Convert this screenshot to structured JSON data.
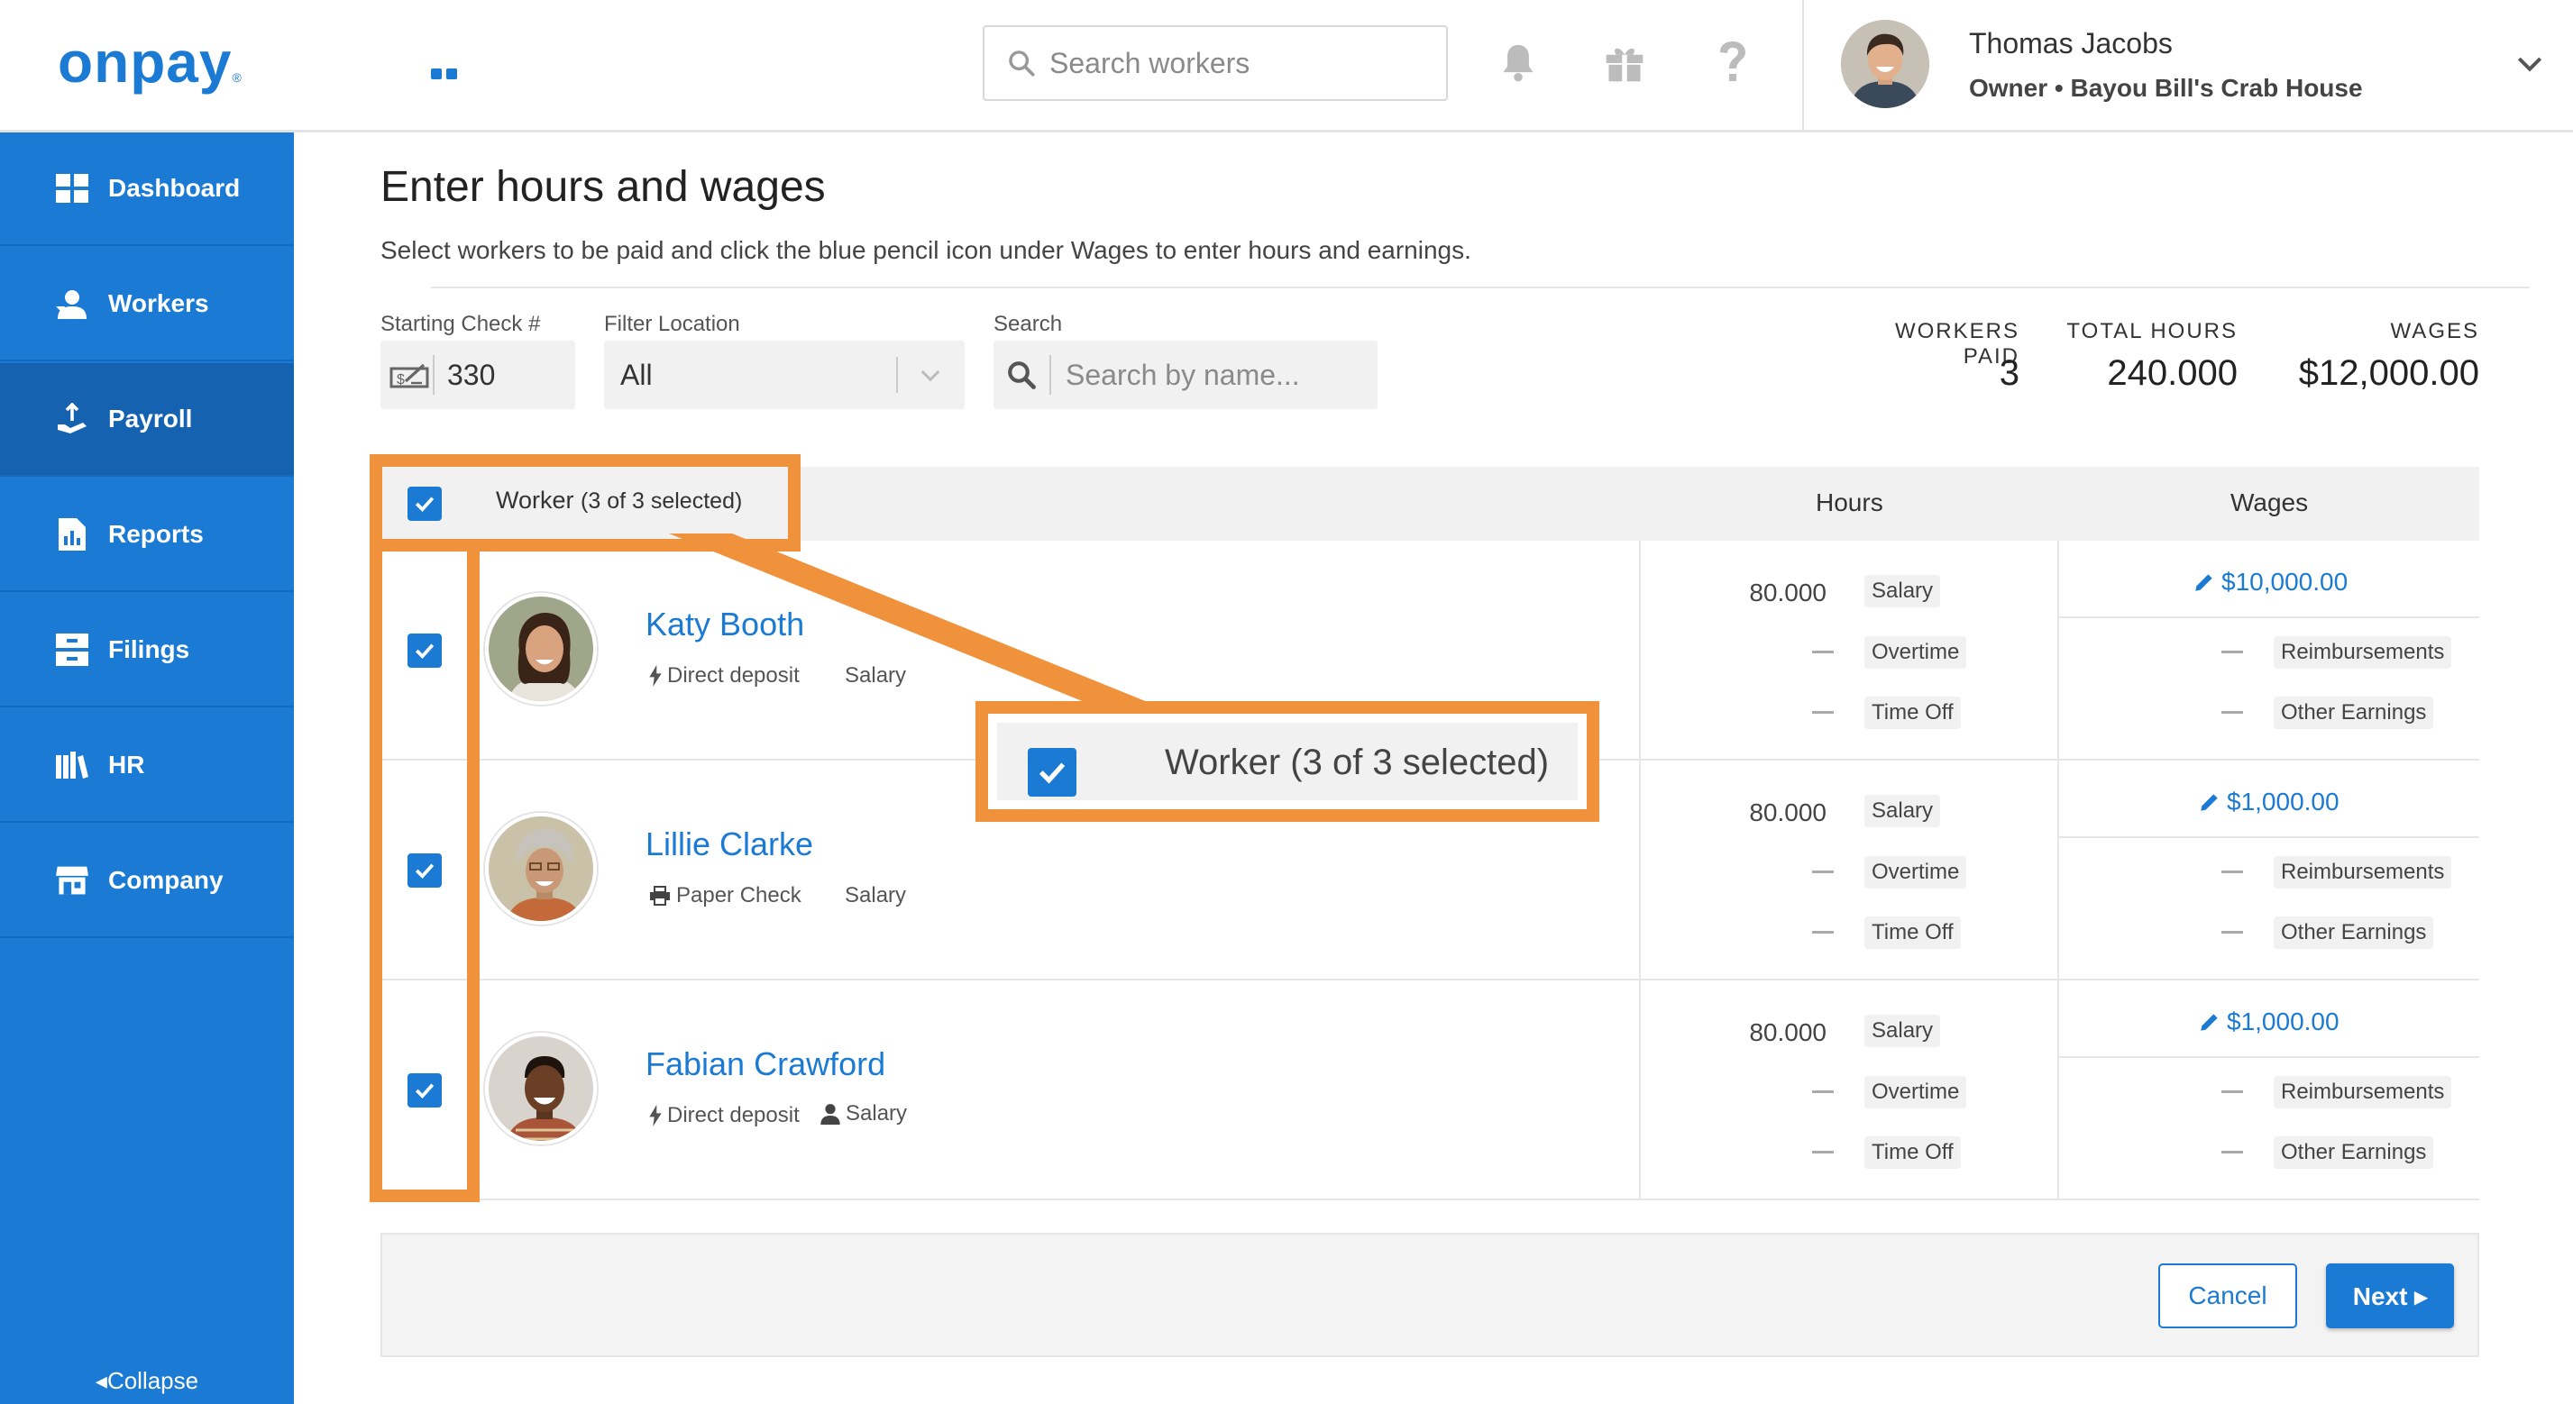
{
  "brand": {
    "name": "onpay",
    "reg_mark": "®",
    "accent": "#1a7ad4",
    "annotation": "#f0913b"
  },
  "topbar": {
    "search_placeholder": "Search workers",
    "icons": [
      "bell-icon",
      "gift-icon",
      "help-icon"
    ],
    "user": {
      "name": "Thomas Jacobs",
      "role": "Owner • Bayou Bill's Crab House"
    }
  },
  "sidebar": {
    "items": [
      {
        "label": "Dashboard",
        "icon": "dashboard-icon"
      },
      {
        "label": "Workers",
        "icon": "workers-icon"
      },
      {
        "label": "Payroll",
        "icon": "payroll-icon",
        "active": true
      },
      {
        "label": "Reports",
        "icon": "reports-icon"
      },
      {
        "label": "Filings",
        "icon": "filings-icon"
      },
      {
        "label": "HR",
        "icon": "hr-icon"
      },
      {
        "label": "Company",
        "icon": "company-icon"
      }
    ],
    "collapse_label": "Collapse"
  },
  "page": {
    "title": "Enter hours and wages",
    "subtitle": "Select workers to be paid and click the blue pencil icon under Wages to enter hours and earnings."
  },
  "filters": {
    "check_label": "Starting Check #",
    "check_value": "330",
    "location_label": "Filter Location",
    "location_value": "All",
    "search_label": "Search",
    "search_placeholder": "Search by name..."
  },
  "stats": {
    "workers_paid_label": "WORKERS PAID",
    "workers_paid": "3",
    "total_hours_label": "TOTAL HOURS",
    "total_hours": "240.000",
    "wages_label": "WAGES",
    "wages": "$12,000.00"
  },
  "table": {
    "header_worker": "Worker",
    "header_worker_count": "(3 of 3 selected)",
    "header_hours": "Hours",
    "header_wages": "Wages",
    "hour_tags": [
      "Salary",
      "Overtime",
      "Time Off"
    ],
    "wage_tags": [
      "Reimbursements",
      "Other Earnings"
    ],
    "rows": [
      {
        "name": "Katy Booth",
        "payment": "Direct deposit",
        "type": "Salary",
        "hours": "80.000",
        "wage": "$10,000.00",
        "checked": true
      },
      {
        "name": "Lillie Clarke",
        "payment": "Paper Check",
        "type": "Salary",
        "hours": "80.000",
        "wage": "$1,000.00",
        "checked": true
      },
      {
        "name": "Fabian Crawford",
        "payment": "Direct deposit",
        "type": "Salary",
        "hours": "80.000",
        "wage": "$1,000.00",
        "checked": true
      }
    ]
  },
  "callout": {
    "text": "Worker (3 of 3 selected)"
  },
  "footer": {
    "cancel_label": "Cancel",
    "next_label": "Next"
  }
}
